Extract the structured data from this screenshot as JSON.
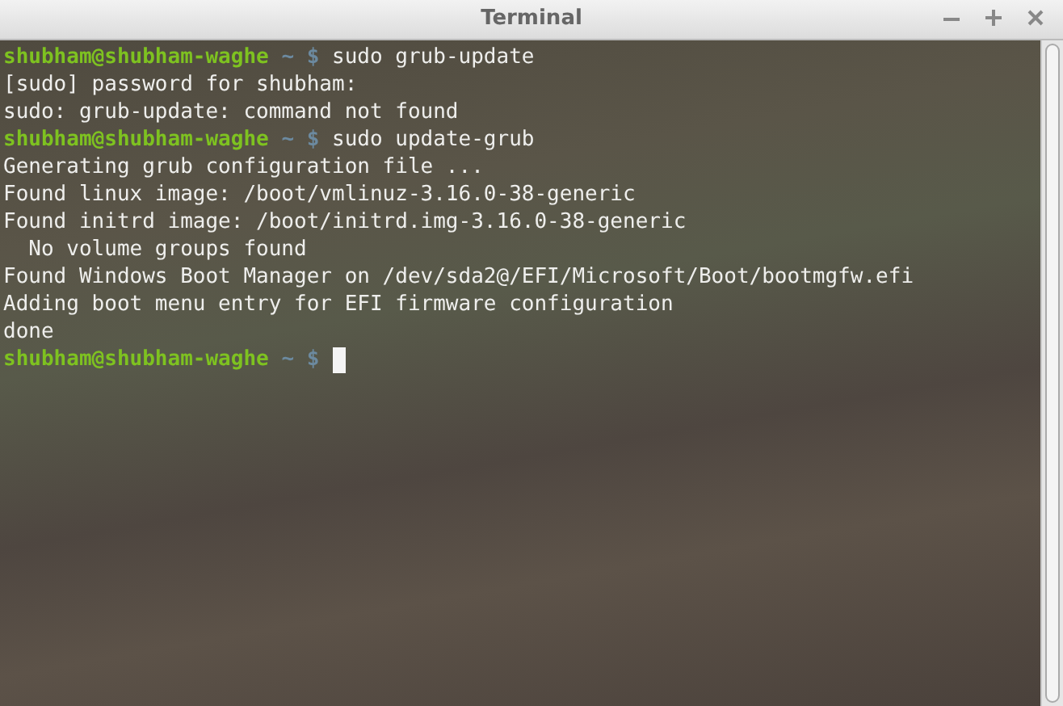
{
  "window": {
    "title": "Terminal"
  },
  "terminal": {
    "lines": [
      {
        "kind": "prompt",
        "user_host": "shubham@shubham-waghe",
        "path": "~",
        "symbol": "$",
        "command": "sudo grub-update",
        "cursor": false
      },
      {
        "kind": "output",
        "text": "[sudo] password for shubham:"
      },
      {
        "kind": "output",
        "text": "sudo: grub-update: command not found"
      },
      {
        "kind": "prompt",
        "user_host": "shubham@shubham-waghe",
        "path": "~",
        "symbol": "$",
        "command": "sudo update-grub",
        "cursor": false
      },
      {
        "kind": "output",
        "text": "Generating grub configuration file ..."
      },
      {
        "kind": "output",
        "text": "Found linux image: /boot/vmlinuz-3.16.0-38-generic"
      },
      {
        "kind": "output",
        "text": "Found initrd image: /boot/initrd.img-3.16.0-38-generic"
      },
      {
        "kind": "output",
        "text": "  No volume groups found"
      },
      {
        "kind": "output",
        "text": "Found Windows Boot Manager on /dev/sda2@/EFI/Microsoft/Boot/bootmgfw.efi"
      },
      {
        "kind": "output",
        "text": "Adding boot menu entry for EFI firmware configuration"
      },
      {
        "kind": "output",
        "text": "done"
      },
      {
        "kind": "prompt",
        "user_host": "shubham@shubham-waghe",
        "path": "~",
        "symbol": "$",
        "cursor": true
      }
    ]
  }
}
